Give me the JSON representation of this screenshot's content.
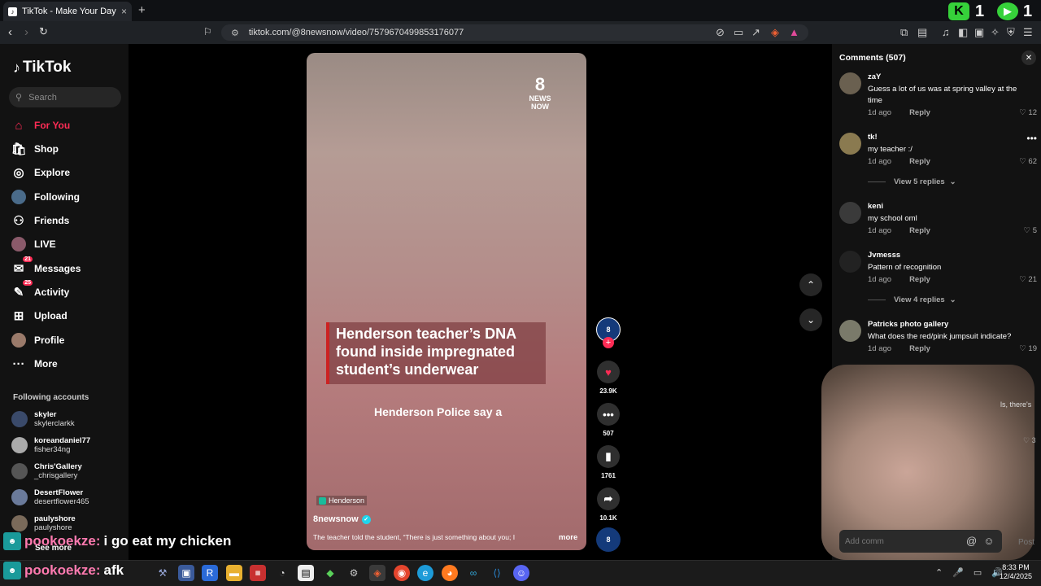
{
  "browser": {
    "tab_title": "TikTok - Make Your Day",
    "tab_close": "×",
    "new_tab": "+",
    "url": "tiktok.com/@8newsnow/video/7579670499853176077",
    "ext_k_count": "1",
    "ext_play_count": "1"
  },
  "sidebar": {
    "logo": "TikTok",
    "search_placeholder": "Search",
    "nav": [
      {
        "label": "For You",
        "icon": "home-icon",
        "active": true
      },
      {
        "label": "Shop",
        "icon": "shop-icon"
      },
      {
        "label": "Explore",
        "icon": "compass-icon"
      },
      {
        "label": "Following",
        "icon": "following-avatar"
      },
      {
        "label": "Friends",
        "icon": "friends-icon"
      },
      {
        "label": "LIVE",
        "icon": "live-avatar"
      },
      {
        "label": "Messages",
        "icon": "messages-icon",
        "badge": "21"
      },
      {
        "label": "Activity",
        "icon": "activity-icon",
        "badge": "25"
      },
      {
        "label": "Upload",
        "icon": "upload-icon"
      },
      {
        "label": "Profile",
        "icon": "profile-avatar"
      },
      {
        "label": "More",
        "icon": "more-icon"
      }
    ],
    "following_header": "Following accounts",
    "following": [
      {
        "name": "skyler",
        "handle": "skylerclarkk"
      },
      {
        "name": "koreandaniel77",
        "handle": "fisher34ng"
      },
      {
        "name": "Chris'Gallery",
        "handle": "_chrisgallery"
      },
      {
        "name": "DesertFlower",
        "handle": "desertflower465"
      },
      {
        "name": "paulyshore",
        "handle": "paulyshore"
      }
    ],
    "see_more": "See more"
  },
  "video": {
    "logo_num": "8",
    "logo_line1": "NEWS",
    "logo_line2": "NOW",
    "headline": "Henderson teacher’s DNA found inside impregnated student’s underwear",
    "subtitle": "Henderson Police say a",
    "location": "Henderson",
    "author": "8newsnow",
    "description": "The teacher told the student, “There is just something about you; I",
    "more": "more"
  },
  "actions": {
    "likes": "23.9K",
    "comments": "507",
    "saves": "1761",
    "shares": "10.1K",
    "avatar_label": "8"
  },
  "comments_panel": {
    "title": "Comments (507)",
    "items": [
      {
        "user": "zaY",
        "text": "Guess a lot of us was at spring valley at the time",
        "time": "1d ago",
        "reply": "Reply",
        "likes": "12"
      },
      {
        "user": "tk!",
        "text": "my teacher :/",
        "time": "1d ago",
        "reply": "Reply",
        "likes": "62",
        "replies": "View 5 replies"
      },
      {
        "user": "keni",
        "text": "my school oml",
        "time": "1d ago",
        "reply": "Reply",
        "likes": "5"
      },
      {
        "user": "Jvmesss",
        "text": "Pattern of recognition",
        "time": "1d ago",
        "reply": "Reply",
        "likes": "21",
        "replies": "View 4 replies"
      },
      {
        "user": "Patricks photo gallery",
        "text": "What does the red/pink jumpsuit indicate?",
        "time": "1d ago",
        "reply": "Reply",
        "likes": "19"
      }
    ],
    "partial_text": "ls, there's",
    "partial_likes": "3",
    "add_comment": "Add comm",
    "post": "Post"
  },
  "chat": [
    {
      "name": "pookoekze:",
      "text": "i go eat my chicken"
    },
    {
      "name": "pookoekze:",
      "text": "afk"
    }
  ],
  "taskbar": {
    "time": "8:33 PM",
    "date": "12/4/2025"
  }
}
